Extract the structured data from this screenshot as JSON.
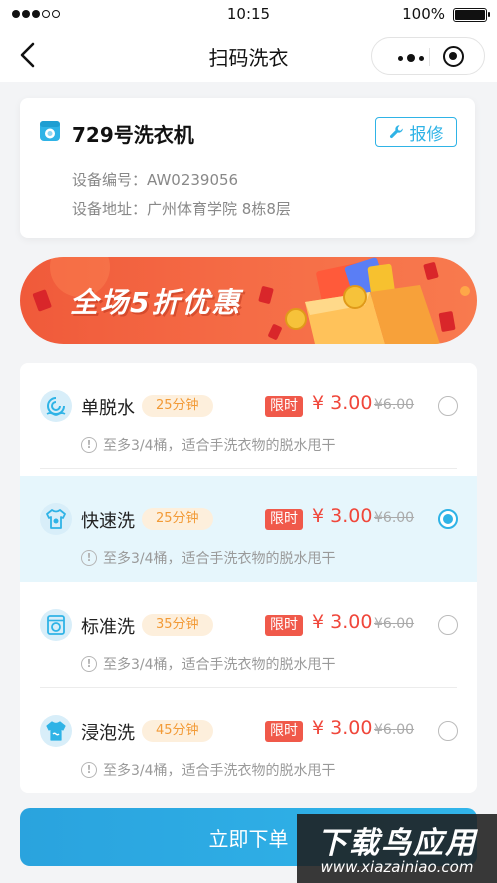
{
  "status_bar": {
    "time": "10:15",
    "battery": "100%"
  },
  "nav": {
    "title": "扫码洗衣"
  },
  "device": {
    "name": "729号洗衣机",
    "repair_label": "报修",
    "code_label": "设备编号：",
    "code_value": "AW0239056",
    "address_label": "设备地址：",
    "address_value": "广州体育学院 8栋8层"
  },
  "banner": {
    "text": "全场5折优惠"
  },
  "options": [
    {
      "name": "单脱水",
      "duration": "25分钟",
      "tag": "限时",
      "price": "¥ 3.00",
      "old_price": "¥6.00",
      "note": "至多3/4桶，适合手洗衣物的脱水甩干",
      "selected": false,
      "icon": "spin-icon"
    },
    {
      "name": "快速洗",
      "duration": "25分钟",
      "tag": "限时",
      "price": "¥ 3.00",
      "old_price": "¥6.00",
      "note": "至多3/4桶，适合手洗衣物的脱水甩干",
      "selected": true,
      "icon": "shirt-icon"
    },
    {
      "name": "标准洗",
      "duration": "35分钟",
      "tag": "限时",
      "price": "¥ 3.00",
      "old_price": "¥6.00",
      "note": "至多3/4桶，适合手洗衣物的脱水甩干",
      "selected": false,
      "icon": "washer-icon"
    },
    {
      "name": "浸泡洗",
      "duration": "45分钟",
      "tag": "限时",
      "price": "¥ 3.00",
      "old_price": "¥6.00",
      "note": "至多3/4桶，适合手洗衣物的脱水甩干",
      "selected": false,
      "icon": "tshirt-icon"
    }
  ],
  "submit": {
    "label": "立即下单"
  },
  "watermark": {
    "top": "下载鸟应用",
    "bottom": "www.xiazainiao.com"
  },
  "colors": {
    "accent": "#2fb3e6",
    "price": "#f0473b",
    "duration": "#f29a36"
  }
}
